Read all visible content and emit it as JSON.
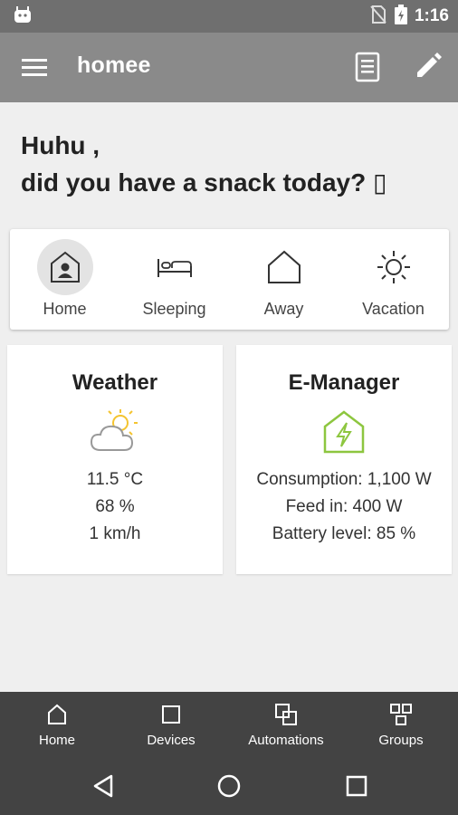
{
  "status_bar": {
    "time": "1:16",
    "icons": [
      "android-debug-icon",
      "no-sim-icon",
      "battery-charging-icon"
    ]
  },
  "app_bar": {
    "title": "homee",
    "icons": [
      "menu-icon",
      "document-icon",
      "edit-icon"
    ]
  },
  "greeting": {
    "line1": "Huhu ,",
    "line2": "did you have a snack today? ▯"
  },
  "modes": [
    {
      "label": "Home",
      "icon": "home-person-icon",
      "active": true
    },
    {
      "label": "Sleeping",
      "icon": "bed-icon",
      "active": false
    },
    {
      "label": "Away",
      "icon": "house-outline-icon",
      "active": false
    },
    {
      "label": "Vacation",
      "icon": "sun-icon",
      "active": false
    }
  ],
  "weather": {
    "title": "Weather",
    "icon": "partly-cloudy-icon",
    "temperature": "11.5 °C",
    "humidity": "68 %",
    "wind": "1 km/h"
  },
  "emanager": {
    "title": "E-Manager",
    "icon": "energy-house-icon",
    "consumption": "Consumption: 1,100 W",
    "feed_in": "Feed in: 400 W",
    "battery": "Battery level: 85 %"
  },
  "bottom_nav": [
    {
      "label": "Home",
      "icon": "home-icon"
    },
    {
      "label": "Devices",
      "icon": "devices-icon"
    },
    {
      "label": "Automations",
      "icon": "automations-icon"
    },
    {
      "label": "Groups",
      "icon": "groups-icon"
    }
  ],
  "colors": {
    "app_bar": "#8a8a8a",
    "status_bar": "#6f6f6f",
    "background": "#efefef",
    "bottom_nav": "#434343",
    "energy_green": "#8dc63f",
    "sun_yellow": "#f4c430"
  }
}
